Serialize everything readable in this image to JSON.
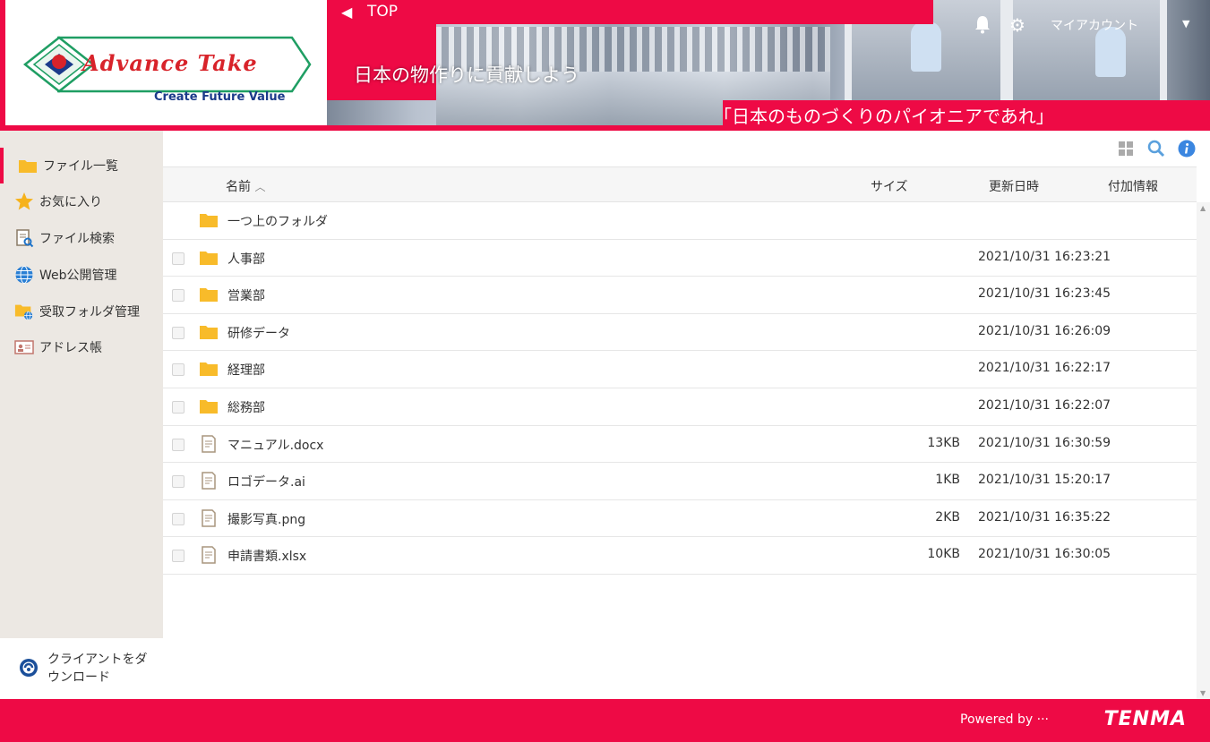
{
  "brand": {
    "name": "Advance Take",
    "tagline": "Create Future Value"
  },
  "banner": {
    "top_label": "TOP",
    "slogan": "日本の物作りに貢献しよう",
    "quote": "「日本のものづくりのパイオニアであれ」"
  },
  "header": {
    "account_label": "マイアカウント"
  },
  "sidebar": {
    "items": [
      {
        "label": "ファイル一覧",
        "icon": "folder-icon",
        "active": true
      },
      {
        "label": "お気に入り",
        "icon": "star-icon",
        "active": false
      },
      {
        "label": "ファイル検索",
        "icon": "file-search-icon",
        "active": false
      },
      {
        "label": "Web公開管理",
        "icon": "globe-icon",
        "active": false
      },
      {
        "label": "受取フォルダ管理",
        "icon": "receive-folder-icon",
        "active": false
      },
      {
        "label": "アドレス帳",
        "icon": "address-book-icon",
        "active": false
      }
    ],
    "client_download": "クライアントをダウンロード"
  },
  "file_list": {
    "columns": {
      "name": "名前",
      "size": "サイズ",
      "modified": "更新日時",
      "extra": "付加情報"
    },
    "parent_folder": "一つ上のフォルダ",
    "rows": [
      {
        "type": "folder",
        "name": "人事部",
        "size": "",
        "modified": "2021/10/31 16:23:21"
      },
      {
        "type": "folder",
        "name": "営業部",
        "size": "",
        "modified": "2021/10/31 16:23:45"
      },
      {
        "type": "folder",
        "name": "研修データ",
        "size": "",
        "modified": "2021/10/31 16:26:09"
      },
      {
        "type": "folder",
        "name": "経理部",
        "size": "",
        "modified": "2021/10/31 16:22:17"
      },
      {
        "type": "folder",
        "name": "総務部",
        "size": "",
        "modified": "2021/10/31 16:22:07"
      },
      {
        "type": "file",
        "name": "マニュアル.docx",
        "size": "13KB",
        "modified": "2021/10/31 16:30:59"
      },
      {
        "type": "file",
        "name": "ロゴデータ.ai",
        "size": "1KB",
        "modified": "2021/10/31 15:20:17"
      },
      {
        "type": "file",
        "name": "撮影写真.png",
        "size": "2KB",
        "modified": "2021/10/31 16:35:22"
      },
      {
        "type": "file",
        "name": "申請書類.xlsx",
        "size": "10KB",
        "modified": "2021/10/31 16:30:05"
      }
    ]
  },
  "footer": {
    "powered_by": "Powered by ···",
    "vendor": "TENMA"
  },
  "colors": {
    "accent": "#ee0a45",
    "folder": "#f8bb2a",
    "sidebar_bg": "#ece8e3"
  }
}
